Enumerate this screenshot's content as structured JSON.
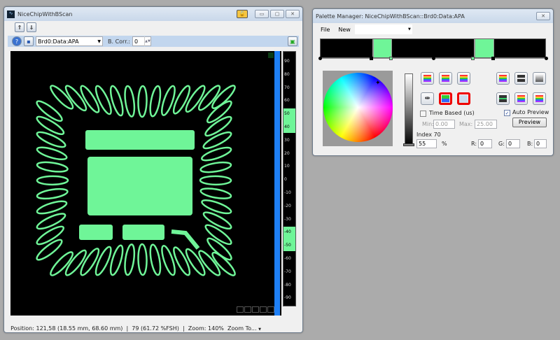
{
  "main_window": {
    "title": "NiceChipWithBScan",
    "toolbar": {
      "move_up_icon": "arrow-up-box-icon",
      "move_down_icon": "arrow-down-box-icon"
    },
    "controls": {
      "dataset_select": "Brd0:Data:APA",
      "bcorr_label": "B. Corr.:",
      "bcorr_value": "0"
    },
    "scale": {
      "ticks": [
        "90",
        "80",
        "70",
        "60",
        "50",
        "40",
        "30",
        "20",
        "10",
        "0",
        "-10",
        "-20",
        "-30",
        "-40",
        "-50",
        "-60",
        "-70",
        "-80",
        "-90"
      ],
      "highlight_color": "#6ff598",
      "highlight_ranges": [
        [
          "50",
          "40"
        ],
        [
          "-40",
          "-50"
        ]
      ]
    },
    "image": {
      "foreground_color": "#6ff598",
      "background_color": "#000000"
    },
    "status": {
      "position": "Position: 121,58 (18.55 mm, 68.60 mm)",
      "amplitude": "79 (61.72 %FSH)",
      "zoom": "Zoom: 140%",
      "zoom_to": "Zoom To..."
    }
  },
  "palette_window": {
    "title": "Palette Manager: NiceChipWithBScan::Brd0:Data:APA",
    "menu": {
      "file": "File",
      "new": "New",
      "new_select": ""
    },
    "time_based_label": "Time Based (us)",
    "time_based_checked": false,
    "min_label": "Min:",
    "min_value": "0.00",
    "max_label": "Max:",
    "max_value": "25.00",
    "auto_preview_label": "Auto Preview",
    "auto_preview_checked": true,
    "preview_button": "Preview",
    "index_label": "Index 70",
    "percent_value": "55",
    "percent_unit": "%",
    "r_label": "R:",
    "r_value": "0",
    "g_label": "G:",
    "g_value": "0",
    "b_label": "B:",
    "b_value": "0"
  }
}
